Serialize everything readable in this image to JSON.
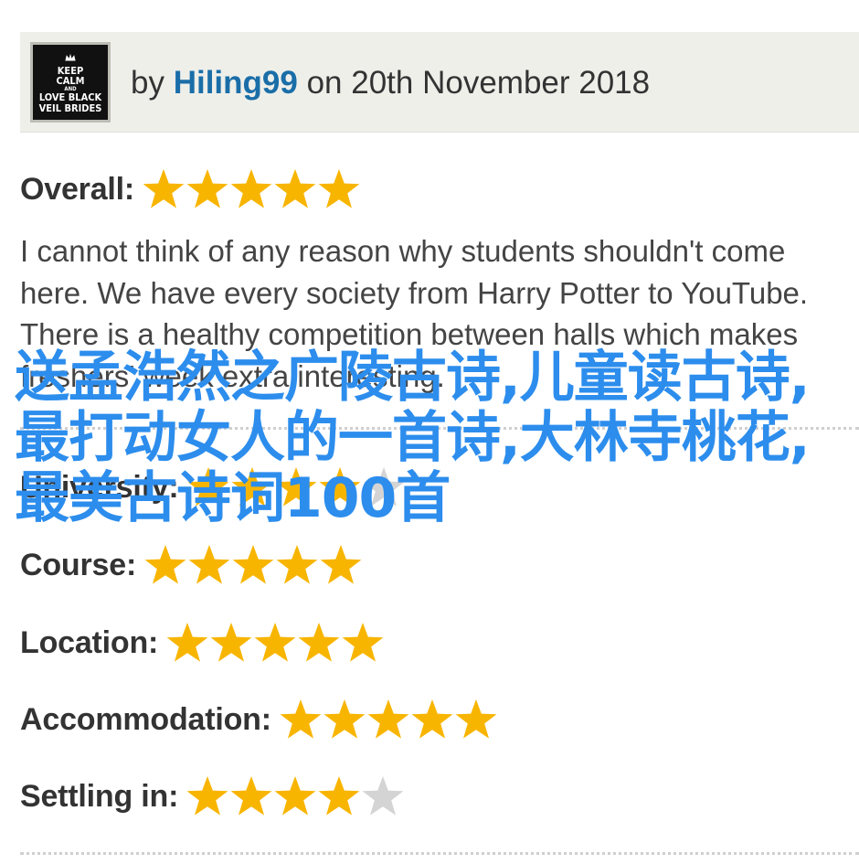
{
  "review": {
    "avatar_text": [
      "KEEP",
      "CALM",
      "AND",
      "LOVE BLACK",
      "VEIL BRIDES"
    ],
    "by_prefix": "by",
    "username": "Hiling99",
    "date_text": "on 20th November 2018",
    "body": "I cannot think of any reason why students shouldn't come here. We have every society from Harry Potter to YouTube. There is a healthy competition between halls which makes freshers' week extra interesting.",
    "max_stars": 5,
    "ratings": [
      {
        "label": "Overall:",
        "stars": 5
      },
      {
        "label": "University:",
        "stars": 4
      },
      {
        "label": "Course:",
        "stars": 5
      },
      {
        "label": "Location:",
        "stars": 5
      },
      {
        "label": "Accommodation:",
        "stars": 5
      },
      {
        "label": "Settling in:",
        "stars": 4
      }
    ]
  },
  "overlay_text": "送孟浩然之广陵古诗,儿童读古诗,最打动女人的一首诗,大林寺桃花,最美古诗词100首",
  "colors": {
    "star_filled": "#f8b500",
    "star_empty": "#d4d4d4",
    "username": "#1a6ea8",
    "overlay": "#2c8ded",
    "header_bg": "#efefea"
  }
}
